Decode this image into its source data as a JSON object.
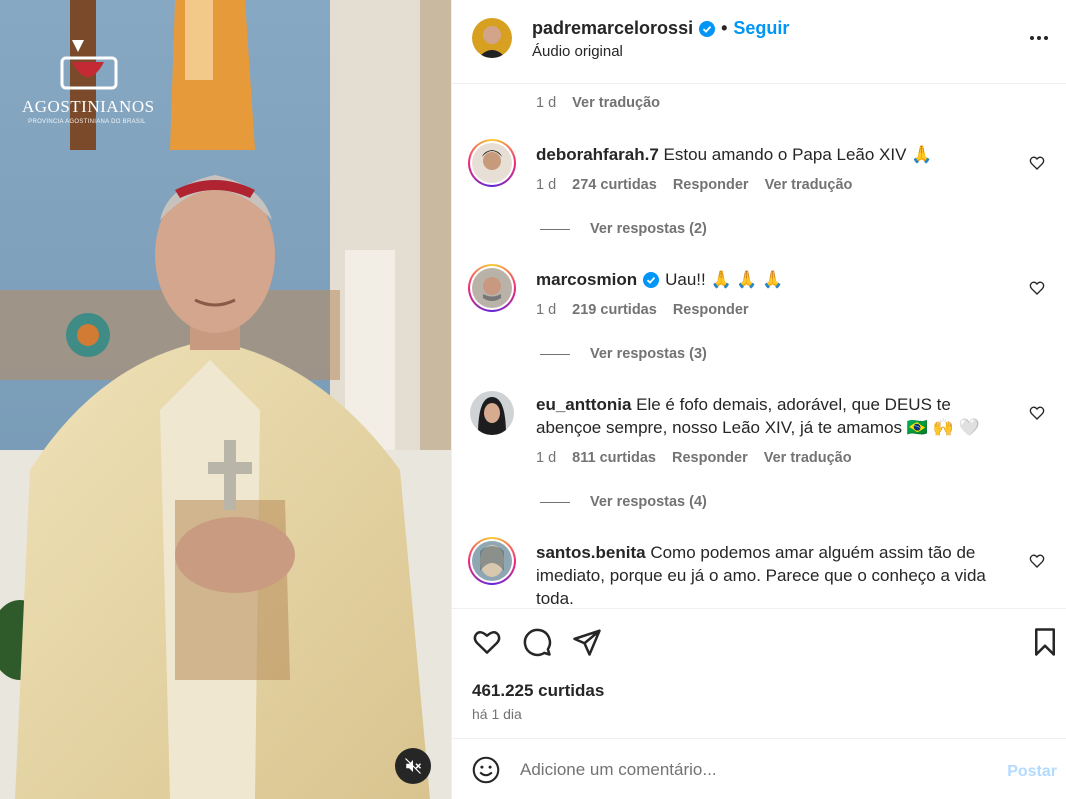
{
  "media": {
    "logo_title": "AGOSTINIANOS",
    "logo_subtitle": "PROVÍNCIA AGOSTINIANA DO BRASIL",
    "mute_icon": "speaker-muted-icon"
  },
  "header": {
    "username": "padremarcelorossi",
    "verified": true,
    "separator": "•",
    "follow_label": "Seguir",
    "audio_label": "Áudio original",
    "more_icon": "more-horizontal-icon"
  },
  "comments": {
    "top_meta": {
      "time": "1 d",
      "translate": "Ver tradução"
    },
    "items": [
      {
        "username": "deborahfarah.7",
        "text": "Estou amando o Papa Leão XIV 🙏",
        "time": "1 d",
        "likes": "274 curtidas",
        "reply": "Responder",
        "translate": "Ver tradução",
        "view_replies": "Ver respostas (2)"
      },
      {
        "username": "marcosmion",
        "verified": true,
        "text": "Uau!! 🙏 🙏 🙏",
        "time": "1 d",
        "likes": "219 curtidas",
        "reply": "Responder",
        "view_replies": "Ver respostas (3)"
      },
      {
        "username": "eu_anttonia",
        "text": "Ele é fofo demais, adorável, que DEUS te abençoe sempre, nosso Leão XIV, já te amamos 🇧🇷 🙌 🤍",
        "time": "1 d",
        "likes": "811 curtidas",
        "reply": "Responder",
        "translate": "Ver tradução",
        "view_replies": "Ver respostas (4)"
      },
      {
        "username": "santos.benita",
        "text": "Como podemos amar alguém assim tão de imediato, porque eu já o amo. Parece que o conheço a vida toda."
      }
    ]
  },
  "actions": {
    "like_icon": "heart-icon",
    "comment_icon": "comment-icon",
    "share_icon": "send-icon",
    "save_icon": "bookmark-icon",
    "likes_total": "461.225 curtidas",
    "posted": "há 1 dia"
  },
  "add_comment": {
    "emoji_icon": "smiley-icon",
    "placeholder": "Adicione um comentário...",
    "post_label": "Postar"
  },
  "colors": {
    "accent": "#0095f6",
    "text": "#262626",
    "secondary": "#737373",
    "post_disabled": "#b3dbff"
  }
}
